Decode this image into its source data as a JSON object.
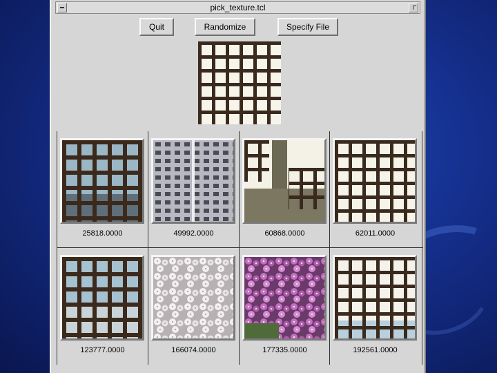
{
  "window": {
    "title": "pick_texture.tcl"
  },
  "toolbar": {
    "quit_label": "Quit",
    "randomize_label": "Randomize",
    "specify_label": "Specify File"
  },
  "preview": {
    "image": "window-grid-texture"
  },
  "textures": [
    {
      "label": "25818.0000",
      "image": "grid-sky-texture"
    },
    {
      "label": "49992.0000",
      "image": "building-texture"
    },
    {
      "label": "60868.0000",
      "image": "ruin-window-texture"
    },
    {
      "label": "62011.0000",
      "image": "window-grid-texture"
    },
    {
      "label": "123777.0000",
      "image": "grid-water-texture"
    },
    {
      "label": "166074.0000",
      "image": "white-flowers-texture"
    },
    {
      "label": "177335.0000",
      "image": "pink-flowers-texture"
    },
    {
      "label": "192561.0000",
      "image": "window-grid-texture"
    }
  ],
  "colors": {
    "desktop": "#142e8a",
    "window_bg": "#d6d6d6",
    "grid_bar": "#3b2a1c"
  }
}
